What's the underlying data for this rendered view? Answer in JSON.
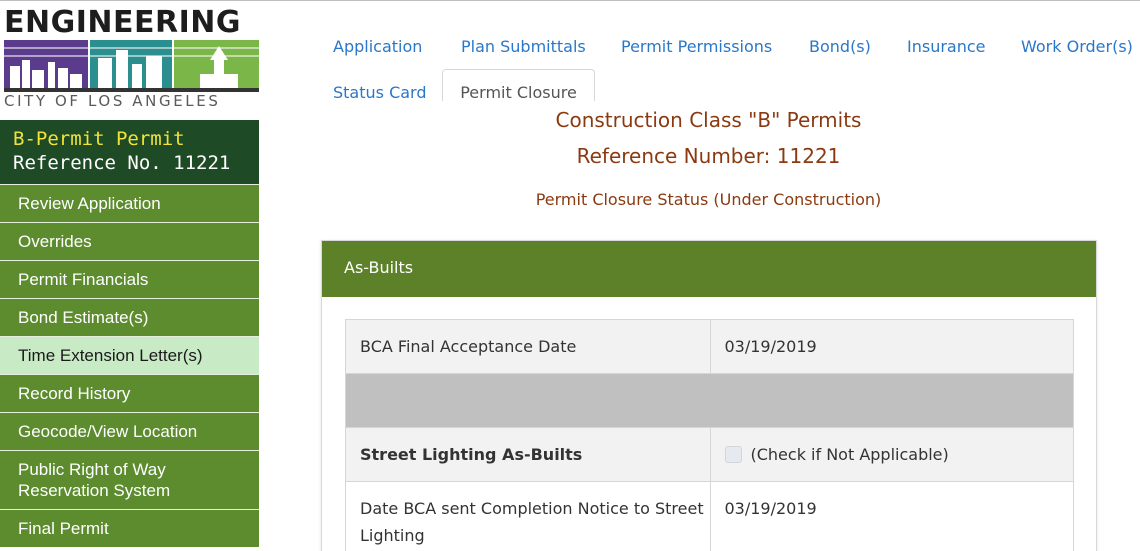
{
  "logo": {
    "title": "ENGINEERING",
    "subtitle": "CITY OF LOS ANGELES",
    "colors": [
      "#5b3b8c",
      "#2c8f8f",
      "#7ab648"
    ]
  },
  "permit": {
    "title": "B-Permit Permit",
    "reference": "Reference No. 11221"
  },
  "sidebar": {
    "items": [
      {
        "label": "Review Application"
      },
      {
        "label": "Overrides"
      },
      {
        "label": "Permit Financials"
      },
      {
        "label": "Bond Estimate(s)"
      },
      {
        "label": "Time Extension Letter(s)"
      },
      {
        "label": "Record History"
      },
      {
        "label": "Geocode/View Location"
      },
      {
        "label": "Public Right of Way Reservation System"
      },
      {
        "label": "Final Permit"
      }
    ]
  },
  "tabs": [
    {
      "label": "Application"
    },
    {
      "label": "Plan Submittals"
    },
    {
      "label": "Permit Permissions"
    },
    {
      "label": "Bond(s)"
    },
    {
      "label": "Insurance"
    },
    {
      "label": "Work Order(s)"
    },
    {
      "label": "Status Card"
    },
    {
      "label": "Permit Closure"
    }
  ],
  "main": {
    "title": "Construction Class \"B\" Permits",
    "reference": "Reference Number: 11221",
    "status": "Permit Closure Status (Under Construction)"
  },
  "panel": {
    "heading": "As-Builts",
    "rows": {
      "bca_label": "BCA Final Acceptance Date",
      "bca_value": "03/19/2019",
      "street_label": "Street Lighting As-Builts",
      "street_checkbox": "(Check if Not Applicable)",
      "notice_label": "Date BCA sent Completion Notice to Street Lighting",
      "notice_value": "03/19/2019"
    }
  },
  "colors": {
    "sidebar_green": "#5c8c2e",
    "sidebar_active": "#c8ebc6",
    "permit_box": "#1f4a26",
    "permit_title": "#f2e33a",
    "panel_header": "#5c8129",
    "heading_brown": "#8b3a10",
    "link_blue": "#2a77c9"
  }
}
